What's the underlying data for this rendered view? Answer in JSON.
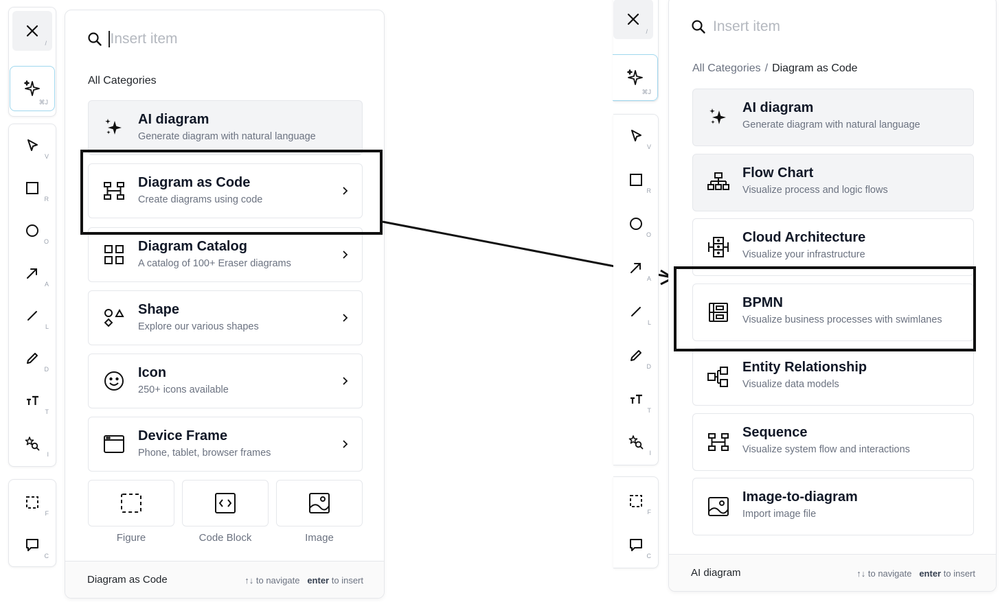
{
  "left": {
    "toolbar": {
      "close_hint": "/",
      "ai_hint": "⌘J",
      "tools": [
        {
          "name": "select",
          "hint": "V"
        },
        {
          "name": "rectangle",
          "hint": "R"
        },
        {
          "name": "ellipse",
          "hint": "O"
        },
        {
          "name": "arrow",
          "hint": "A"
        },
        {
          "name": "line",
          "hint": "L"
        },
        {
          "name": "pencil",
          "hint": "D"
        },
        {
          "name": "text",
          "hint": "T"
        },
        {
          "name": "insert",
          "hint": "I"
        }
      ],
      "bottom_tools": [
        {
          "name": "frame",
          "hint": "F"
        },
        {
          "name": "comment",
          "hint": "C"
        }
      ]
    },
    "search": {
      "placeholder": "Insert item"
    },
    "breadcrumb": {
      "root": "All Categories"
    },
    "items": [
      {
        "title": "AI diagram",
        "subtitle": "Generate diagram with natural language"
      },
      {
        "title": "Diagram as Code",
        "subtitle": "Create diagrams using code"
      },
      {
        "title": "Diagram Catalog",
        "subtitle": "A catalog of 100+ Eraser diagrams"
      },
      {
        "title": "Shape",
        "subtitle": "Explore our various shapes"
      },
      {
        "title": "Icon",
        "subtitle": "250+ icons available"
      },
      {
        "title": "Device Frame",
        "subtitle": "Phone, tablet, browser frames"
      }
    ],
    "tiles": [
      {
        "label": "Figure"
      },
      {
        "label": "Code Block"
      },
      {
        "label": "Image"
      }
    ],
    "footer": {
      "current": "Diagram as Code",
      "nav_arrows": "↑↓",
      "nav_text": "to navigate",
      "enter_key": "enter",
      "enter_text": "to insert"
    }
  },
  "right": {
    "toolbar": {
      "close_hint": "/",
      "ai_hint": "⌘J",
      "tools": [
        {
          "name": "select",
          "hint": "V"
        },
        {
          "name": "rectangle",
          "hint": "R"
        },
        {
          "name": "ellipse",
          "hint": "O"
        },
        {
          "name": "arrow",
          "hint": "A"
        },
        {
          "name": "line",
          "hint": "L"
        },
        {
          "name": "pencil",
          "hint": "D"
        },
        {
          "name": "text",
          "hint": "T"
        },
        {
          "name": "insert",
          "hint": "I"
        }
      ],
      "bottom_tools": [
        {
          "name": "frame",
          "hint": "F"
        },
        {
          "name": "comment",
          "hint": "C"
        }
      ]
    },
    "search": {
      "placeholder": "Insert item"
    },
    "breadcrumb": {
      "root": "All Categories",
      "separator": "/",
      "current": "Diagram as Code"
    },
    "items": [
      {
        "title": "AI diagram",
        "subtitle": "Generate diagram with natural language"
      },
      {
        "title": "Flow Chart",
        "subtitle": "Visualize process and logic flows"
      },
      {
        "title": "Cloud Architecture",
        "subtitle": "Visualize your infrastructure"
      },
      {
        "title": "BPMN",
        "subtitle": "Visualize business processes with swimlanes"
      },
      {
        "title": "Entity Relationship",
        "subtitle": "Visualize data models"
      },
      {
        "title": "Sequence",
        "subtitle": "Visualize system flow and interactions"
      },
      {
        "title": "Image-to-diagram",
        "subtitle": "Import image file"
      }
    ],
    "footer": {
      "current": "AI diagram",
      "nav_arrows": "↑↓",
      "nav_text": "to navigate",
      "enter_key": "enter",
      "enter_text": "to insert"
    }
  }
}
